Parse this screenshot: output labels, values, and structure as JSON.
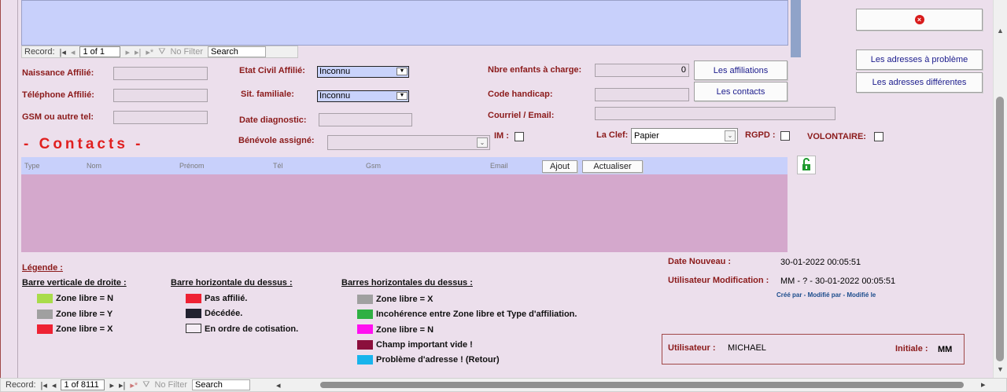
{
  "top_nav": {
    "record_label": "Record:",
    "position": "1 of 1",
    "filter_label": "No Filter",
    "search_value": "Search"
  },
  "buttons": {
    "close_icon": "close-icon",
    "adresses_probleme": "Les adresses à problème",
    "adresses_differentes": "Les adresses différentes",
    "affiliations": "Les affiliations",
    "contacts": "Les contacts",
    "ajout": "Ajout",
    "actualiser": "Actualiser"
  },
  "fields": {
    "naissance_label": "Naissance Affilié:",
    "telephone_label": "Téléphone Affilié:",
    "gsm_label": "GSM ou autre tel:",
    "etat_civil_label": "Etat Civil Affilié:",
    "etat_civil_value": "Inconnu",
    "sit_fam_label": "Sit. familiale:",
    "sit_fam_value": "Inconnu",
    "date_diag_label": "Date diagnostic:",
    "benevole_label": "Bénévole assigné:",
    "nbre_enfants_label": "Nbre enfants à charge:",
    "nbre_enfants_value": "0",
    "code_handicap_label": "Code handicap:",
    "courriel_label": "Courriel / Email:",
    "im_label": "IM :",
    "la_clef_label": "La Clef:",
    "la_clef_value": "Papier",
    "rgpd_label": "RGPD :",
    "volontaire_label": "VOLONTAIRE:"
  },
  "contacts": {
    "title": "- Contacts -",
    "columns": [
      "Type",
      "Nom",
      "Prénom",
      "Tél",
      "Gsm",
      "Email"
    ]
  },
  "legend": {
    "title": "Légende :",
    "col1_title": "Barre verticale de droite :",
    "col1": [
      {
        "color": "#a9dc4a",
        "text": "Zone libre = N"
      },
      {
        "color": "#a0a0a0",
        "text": "Zone libre = Y"
      },
      {
        "color": "#ee2233",
        "text": "Zone libre = X"
      }
    ],
    "col2_title": "Barre horizontale du dessus :",
    "col2": [
      {
        "color": "#ee2233",
        "text": "Pas affilié."
      },
      {
        "color": "#222230",
        "text": "Décédée."
      },
      {
        "color": "#f4ecf4",
        "text": "En ordre de cotisation."
      }
    ],
    "col3_title": "Barres horizontales du dessus :",
    "col3": [
      {
        "color": "#a0a0a0",
        "text": "Zone libre = X"
      },
      {
        "color": "#2fb043",
        "text": "Incohérence entre Zone libre et Type d'affiliation."
      },
      {
        "color": "#ff10f0",
        "text": "Zone libre = N"
      },
      {
        "color": "#8b0f3c",
        "text": "Champ important vide !"
      },
      {
        "color": "#18b4ec",
        "text": "Problème d'adresse ! (Retour)"
      }
    ]
  },
  "info": {
    "date_nouveau_label": "Date Nouveau :",
    "date_nouveau_value": "30-01-2022 00:05:51",
    "user_modif_label": "Utilisateur Modification :",
    "user_modif_value": "MM - ? - 30-01-2022 00:05:51",
    "cree_par": "Créé par - Modifié par - Modifié le",
    "utilisateur_label": "Utilisateur :",
    "utilisateur_value": "MICHAEL",
    "initiale_label": "Initiale :",
    "initiale_value": "MM"
  },
  "bottom_nav": {
    "record_label": "Record:",
    "position": "1 of 8111",
    "filter_label": "No Filter",
    "search_value": "Search"
  },
  "colors": {
    "form_bg": "#ecdfec",
    "label_red": "#8b1a1a",
    "contacts_title": "#e02020",
    "subform_top": "#c8d0fb",
    "contacts_list_bg": "#d4a8cc"
  }
}
